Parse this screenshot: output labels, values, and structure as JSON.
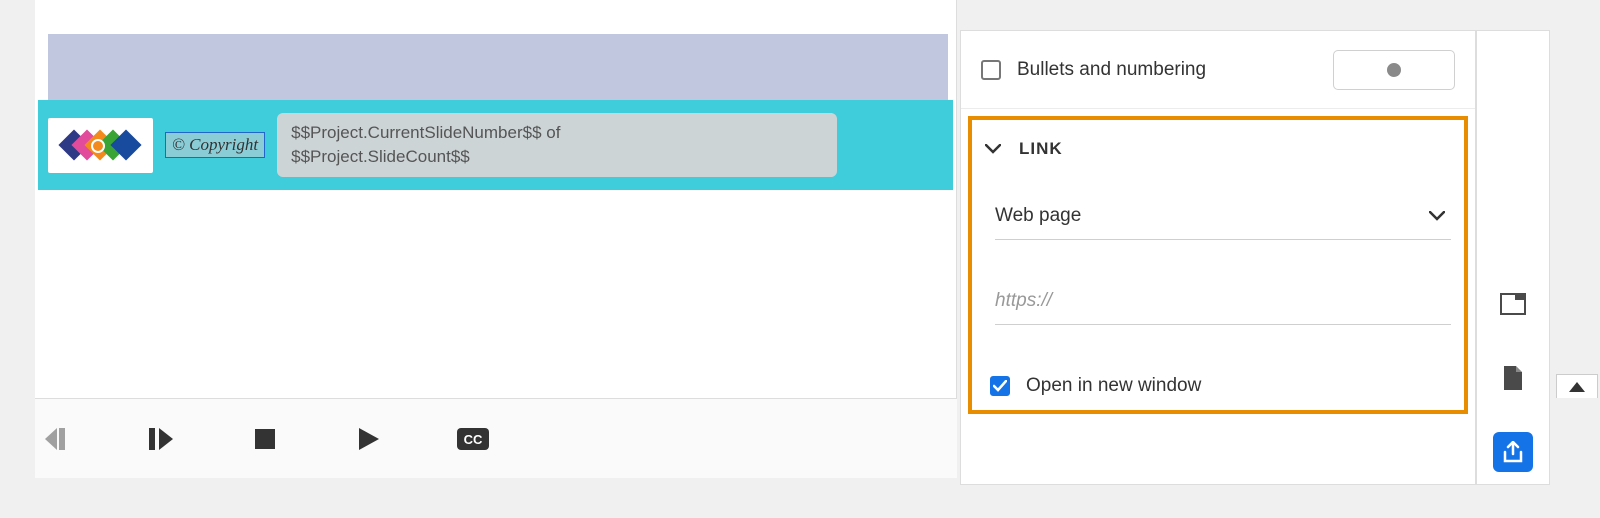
{
  "canvas": {
    "copyright_text": "© Copyright",
    "slide_counter_line1": "$$Project.CurrentSlideNumber$$  of",
    "slide_counter_line2": "$$Project.SlideCount$$"
  },
  "panel": {
    "bullets_label": "Bullets and numbering",
    "bullets_checked": false
  },
  "link": {
    "section_title": "LINK",
    "type_label": "Web page",
    "url_placeholder": "https://",
    "open_new_window_label": "Open in new window",
    "open_new_window_checked": true
  }
}
